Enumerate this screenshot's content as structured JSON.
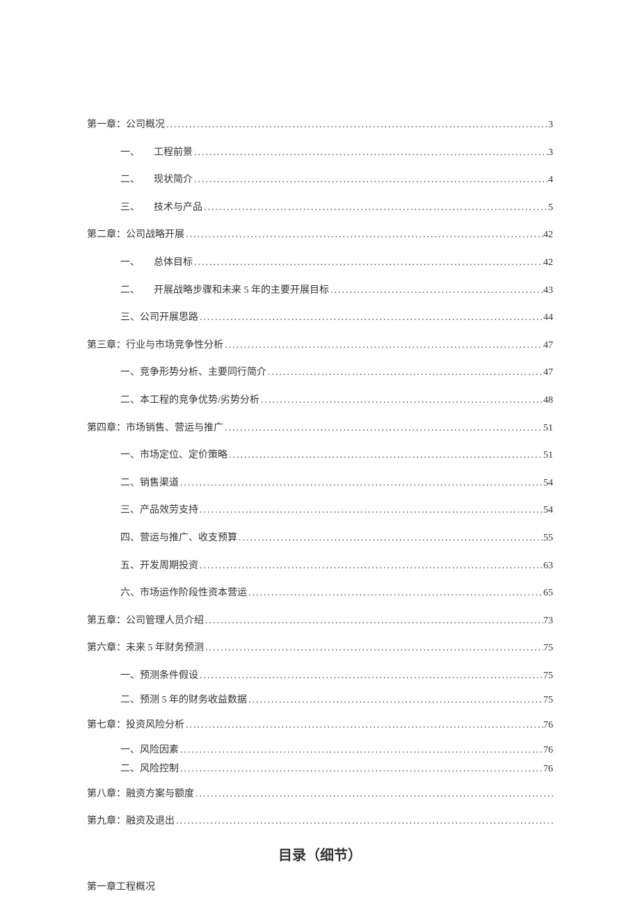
{
  "toc": [
    {
      "level": 0,
      "num": "",
      "label": "第一章：公司概况",
      "page": "3",
      "spacing": "normal"
    },
    {
      "level": 1,
      "num": "一、",
      "label": "工程前景",
      "page": "3",
      "spacing": "normal"
    },
    {
      "level": 1,
      "num": "二、",
      "label": "现状简介",
      "page": "4",
      "spacing": "normal"
    },
    {
      "level": 1,
      "num": "三、",
      "label": "技术与产品",
      "page": "5",
      "spacing": "normal"
    },
    {
      "level": 0,
      "num": "",
      "label": "第二章：公司战略开展",
      "page": "42",
      "spacing": "normal"
    },
    {
      "level": 1,
      "num": "一、",
      "label": "总体目标",
      "page": "42",
      "spacing": "normal"
    },
    {
      "level": 1,
      "num": "二、",
      "label": "开展战略步骤和未来 5 年的主要开展目标",
      "page": "43",
      "spacing": "normal"
    },
    {
      "level": 1,
      "num": "",
      "label": "三、公司开展思路",
      "page": "44",
      "spacing": "normal"
    },
    {
      "level": 0,
      "num": "",
      "label": "第三章：行业与市场竞争性分析",
      "page": "47",
      "spacing": "normal"
    },
    {
      "level": 1,
      "num": "",
      "label": "一、竞争形势分析、主要同行简介",
      "page": "47",
      "spacing": "normal"
    },
    {
      "level": 1,
      "num": "",
      "label": "二、本工程的竞争优势/劣势分析",
      "page": "48",
      "spacing": "normal"
    },
    {
      "level": 0,
      "num": "",
      "label": "第四章：市场销售、营运与推广",
      "page": "51",
      "spacing": "normal"
    },
    {
      "level": 1,
      "num": "",
      "label": "一、市场定位、定价策略",
      "page": "51",
      "spacing": "normal"
    },
    {
      "level": 1,
      "num": "",
      "label": "二、销售渠道",
      "page": "54",
      "spacing": "normal"
    },
    {
      "level": 1,
      "num": "",
      "label": "三、产品效劳支持",
      "page": "54",
      "spacing": "normal"
    },
    {
      "level": 1,
      "num": "",
      "label": "四、营运与推广、收支预算",
      "page": "55",
      "spacing": "normal"
    },
    {
      "level": 1,
      "num": "",
      "label": "五、开发周期投资",
      "page": "63",
      "spacing": "normal"
    },
    {
      "level": 1,
      "num": "",
      "label": "六、市场运作阶段性资本营运",
      "page": "65",
      "spacing": "normal"
    },
    {
      "level": 0,
      "num": "",
      "label": "第五章：公司管理人员介绍",
      "page": "73",
      "spacing": "normal"
    },
    {
      "level": 0,
      "num": "",
      "label": "第六章：未来 5 年财务预测",
      "page": "75",
      "spacing": "normal"
    },
    {
      "level": 1,
      "num": "",
      "label": "一、预测条件假设",
      "page": "75",
      "spacing": "tighter"
    },
    {
      "level": 1,
      "num": "",
      "label": "二、预测 5 年的财务收益数据",
      "page": "75",
      "spacing": "tighter"
    },
    {
      "level": 0,
      "num": "",
      "label": "第七章：投资风险分析",
      "page": "76",
      "spacing": "tighter"
    },
    {
      "level": 1,
      "num": "",
      "label": "一、风险因素",
      "page": "76",
      "spacing": "tight"
    },
    {
      "level": 1,
      "num": "",
      "label": "二、风险控制",
      "page": "76",
      "spacing": "tighter"
    },
    {
      "level": 0,
      "num": "",
      "label": "第八章：融资方案与额度",
      "page": "",
      "spacing": "normal"
    },
    {
      "level": 0,
      "num": "",
      "label": "第九章：融资及退出",
      "page": "",
      "spacing": "normal"
    }
  ],
  "section_title": "目录（细节）",
  "body_line": "第一章工程概况"
}
